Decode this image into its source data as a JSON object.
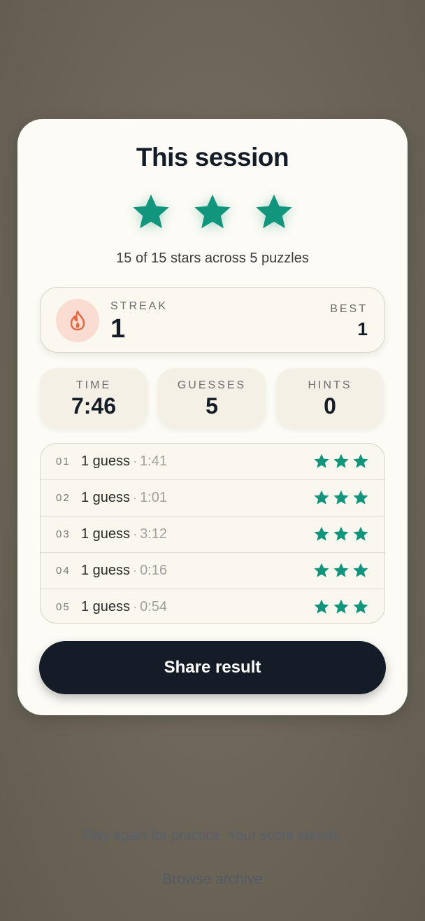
{
  "session": {
    "title": "This session",
    "stars_earned": 3,
    "stars_max": 3,
    "summary": "15 of 15 stars across 5 puzzles"
  },
  "streak": {
    "label": "STREAK",
    "value": "1",
    "best_label": "BEST",
    "best_value": "1"
  },
  "stats": [
    {
      "label": "TIME",
      "value": "7:46"
    },
    {
      "label": "GUESSES",
      "value": "5"
    },
    {
      "label": "HINTS",
      "value": "0"
    }
  ],
  "puzzles": [
    {
      "num": "01",
      "guesses": "1 guess",
      "sep": "·",
      "time": "1:41",
      "stars": 3
    },
    {
      "num": "02",
      "guesses": "1 guess",
      "sep": "·",
      "time": "1:01",
      "stars": 3
    },
    {
      "num": "03",
      "guesses": "1 guess",
      "sep": "·",
      "time": "3:12",
      "stars": 3
    },
    {
      "num": "04",
      "guesses": "1 guess",
      "sep": "·",
      "time": "0:16",
      "stars": 3
    },
    {
      "num": "05",
      "guesses": "1 guess",
      "sep": "·",
      "time": "0:54",
      "stars": 3
    }
  ],
  "actions": {
    "share_label": "Share result",
    "practice_text": "Play again for practice. Your score stands.",
    "archive_label": "Browse archive"
  },
  "colors": {
    "accent_star": "#11957c",
    "fire": "#e2673f",
    "button_bg": "#141d27"
  },
  "icons": {
    "star": "star-icon",
    "streak": "flame-icon"
  }
}
